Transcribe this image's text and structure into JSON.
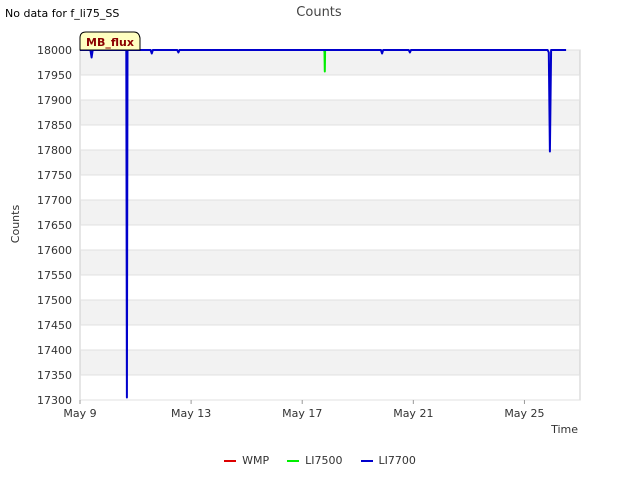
{
  "header": {
    "nodata": "No data for f_li75_SS"
  },
  "site_label": "MB_flux",
  "chart_data": {
    "type": "line",
    "title": "Counts",
    "xlabel": "Time",
    "ylabel": "Counts",
    "ylim": [
      17300,
      18000
    ],
    "yticks": [
      17300,
      17350,
      17400,
      17450,
      17500,
      17550,
      17600,
      17650,
      17700,
      17750,
      17800,
      17850,
      17900,
      17950,
      18000
    ],
    "xlim": [
      "2024-05-09",
      "2024-05-27"
    ],
    "xticks": [
      {
        "label": "May 9",
        "date": "2024-05-09"
      },
      {
        "label": "May 13",
        "date": "2024-05-13"
      },
      {
        "label": "May 17",
        "date": "2024-05-17"
      },
      {
        "label": "May 21",
        "date": "2024-05-21"
      },
      {
        "label": "May 25",
        "date": "2024-05-25"
      }
    ],
    "grid": "horizontal bands",
    "legend_position": "bottom",
    "series": [
      {
        "name": "WMP",
        "color": "#dd0000",
        "points": []
      },
      {
        "name": "LI7500",
        "color": "#00ee00",
        "points": [
          [
            "2024-05-17 19:00",
            18000
          ],
          [
            "2024-05-17 19:15",
            17995
          ],
          [
            "2024-05-17 19:30",
            17957
          ],
          [
            "2024-05-17 19:45",
            18000
          ]
        ]
      },
      {
        "name": "LI7700",
        "color": "#0000cc",
        "points": [
          [
            "2024-05-09 00:00",
            18000
          ],
          [
            "2024-05-09 09:00",
            18000
          ],
          [
            "2024-05-09 10:00",
            17985
          ],
          [
            "2024-05-09 11:00",
            18000
          ],
          [
            "2024-05-10 16:00",
            18000
          ],
          [
            "2024-05-10 16:30",
            17305
          ],
          [
            "2024-05-10 17:00",
            18000
          ],
          [
            "2024-05-11 13:00",
            18000
          ],
          [
            "2024-05-11 14:00",
            17993
          ],
          [
            "2024-05-11 15:00",
            18000
          ],
          [
            "2024-05-12 12:00",
            18000
          ],
          [
            "2024-05-12 13:00",
            17995
          ],
          [
            "2024-05-12 14:00",
            18000
          ],
          [
            "2024-05-19 20:00",
            18000
          ],
          [
            "2024-05-19 21:00",
            17993
          ],
          [
            "2024-05-19 22:00",
            18000
          ],
          [
            "2024-05-20 20:00",
            18000
          ],
          [
            "2024-05-20 21:00",
            17995
          ],
          [
            "2024-05-20 22:00",
            18000
          ],
          [
            "2024-05-25 20:00",
            18000
          ],
          [
            "2024-05-25 21:00",
            17995
          ],
          [
            "2024-05-25 22:00",
            17797
          ],
          [
            "2024-05-25 23:00",
            18000
          ],
          [
            "2024-05-26 12:00",
            18000
          ]
        ]
      }
    ]
  }
}
